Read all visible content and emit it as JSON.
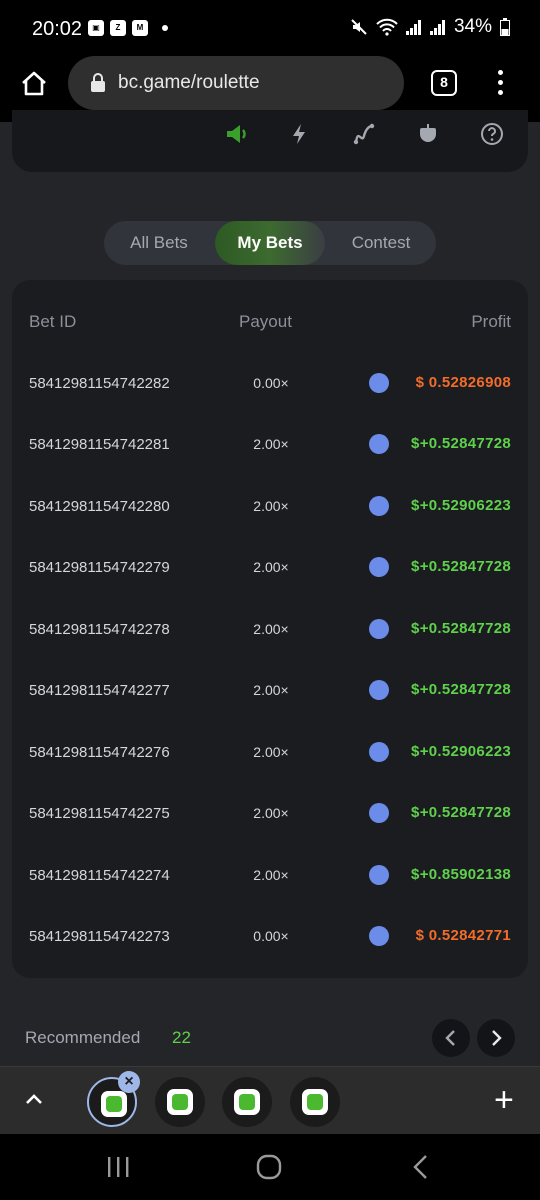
{
  "status_bar": {
    "time": "20:02",
    "battery": "34%"
  },
  "browser": {
    "url": "bc.game/roulette",
    "tab_count": "8"
  },
  "tabs": [
    {
      "label": "All Bets",
      "active": false
    },
    {
      "label": "My Bets",
      "active": true
    },
    {
      "label": "Contest",
      "active": false
    }
  ],
  "table": {
    "headers": {
      "bet_id": "Bet ID",
      "payout": "Payout",
      "profit": "Profit"
    },
    "rows": [
      {
        "id": "58412981154742282",
        "payout": "0.00×",
        "profit": "$  0.52826908",
        "result": "loss"
      },
      {
        "id": "58412981154742281",
        "payout": "2.00×",
        "profit": "$+0.52847728",
        "result": "win"
      },
      {
        "id": "58412981154742280",
        "payout": "2.00×",
        "profit": "$+0.52906223",
        "result": "win"
      },
      {
        "id": "58412981154742279",
        "payout": "2.00×",
        "profit": "$+0.52847728",
        "result": "win"
      },
      {
        "id": "58412981154742278",
        "payout": "2.00×",
        "profit": "$+0.52847728",
        "result": "win"
      },
      {
        "id": "58412981154742277",
        "payout": "2.00×",
        "profit": "$+0.52847728",
        "result": "win"
      },
      {
        "id": "58412981154742276",
        "payout": "2.00×",
        "profit": "$+0.52906223",
        "result": "win"
      },
      {
        "id": "58412981154742275",
        "payout": "2.00×",
        "profit": "$+0.52847728",
        "result": "win"
      },
      {
        "id": "58412981154742274",
        "payout": "2.00×",
        "profit": "$+0.85902138",
        "result": "win"
      },
      {
        "id": "58412981154742273",
        "payout": "0.00×",
        "profit": "$  0.52842771",
        "result": "loss"
      }
    ]
  },
  "recommended": {
    "label": "Recommended",
    "count": "22"
  },
  "colors": {
    "win": "#5fd14b",
    "loss": "#f26d2a",
    "accent_green": "#3aa02b",
    "eth_blue": "#6b8ce8"
  },
  "icons": {
    "top_toolbar": [
      "speaker-icon",
      "lightning-icon",
      "curve-icon",
      "acorn-icon",
      "help-icon"
    ],
    "coin": "ethereum-icon"
  }
}
